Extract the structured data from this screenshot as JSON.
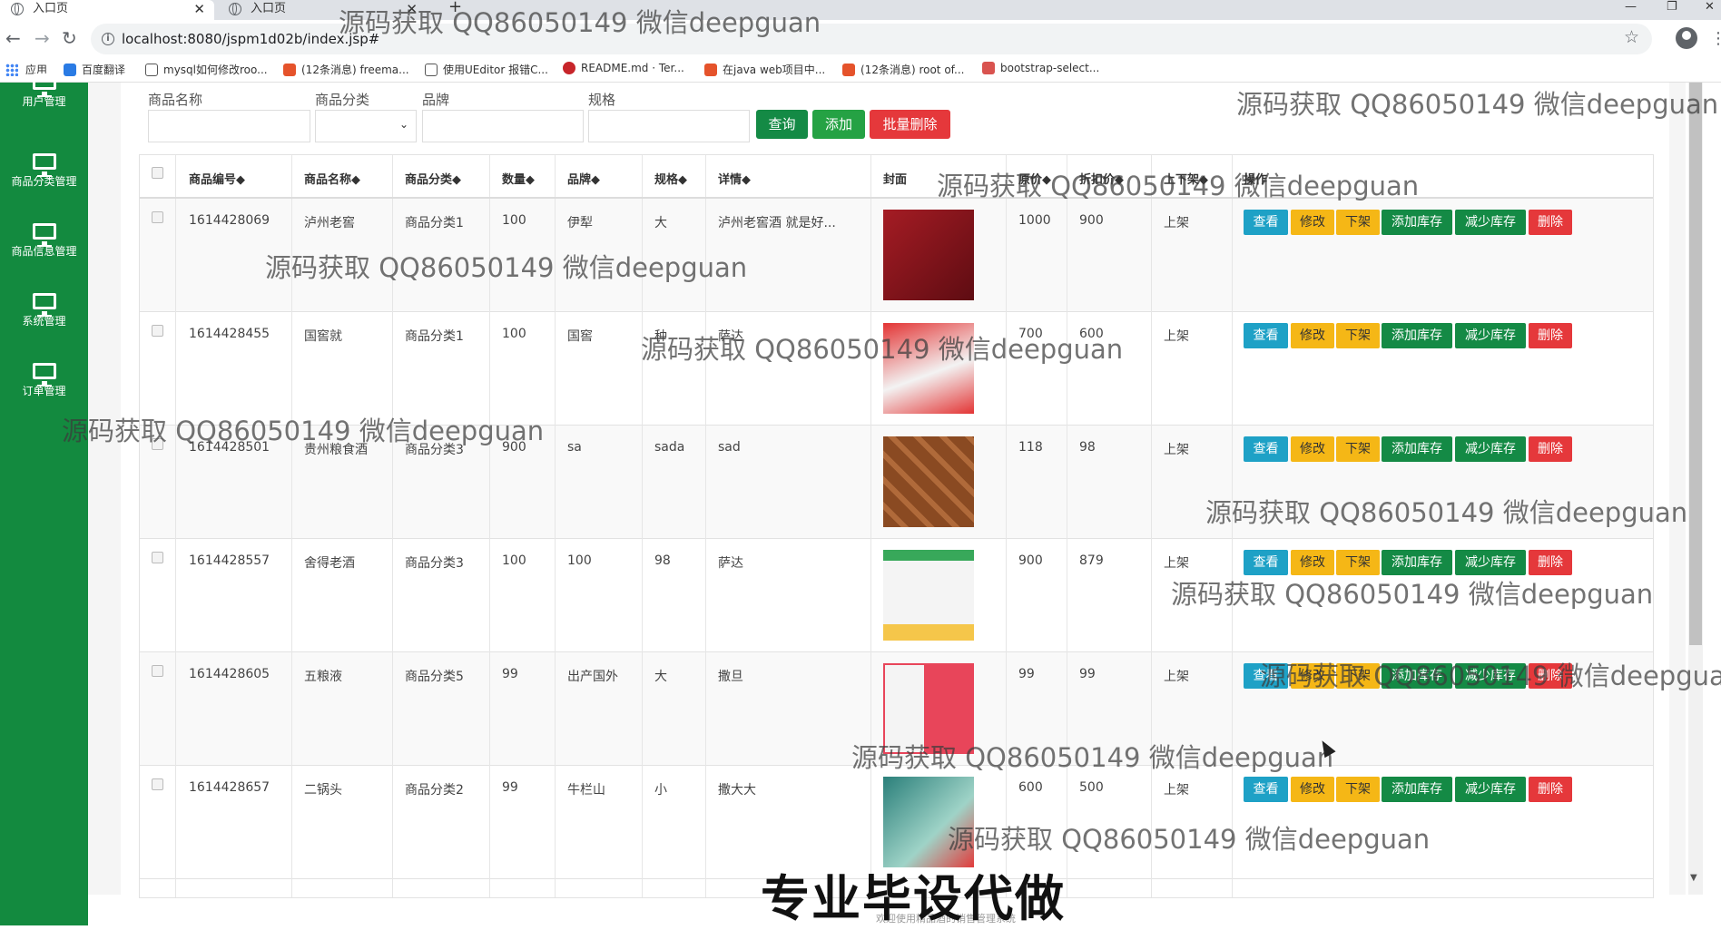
{
  "browser": {
    "tabs": [
      {
        "title": "入口页",
        "close": "✕"
      },
      {
        "title": "入口页",
        "close": "✕"
      }
    ],
    "new_tab": "+",
    "window_buttons": {
      "minimize": "—",
      "maximize": "❐",
      "close": "✕"
    },
    "url": "localhost:8080/jspm1d02b/index.jsp#",
    "bookmarks": [
      {
        "label": "应用",
        "color": "#4285f4"
      },
      {
        "label": "百度翻译",
        "color": "#2a7be4"
      },
      {
        "label": "mysql如何修改roo...",
        "color": "#555555"
      },
      {
        "label": "(12条消息) freema...",
        "color": "#e5532b"
      },
      {
        "label": "使用UEditor 报错C...",
        "color": "#555555"
      },
      {
        "label": "README.md · Ter...",
        "color": "#c7252a"
      },
      {
        "label": "在java web项目中...",
        "color": "#e5532b"
      },
      {
        "label": "(12条消息) root of...",
        "color": "#e5532b"
      },
      {
        "label": "bootstrap-select...",
        "color": "#d9534f"
      }
    ]
  },
  "sidebar": {
    "items": [
      {
        "label": "用户管理"
      },
      {
        "label": "商品分类管理"
      },
      {
        "label": "商品信息管理"
      },
      {
        "label": "系统管理"
      },
      {
        "label": "订单管理"
      }
    ]
  },
  "filters": {
    "name_label": "商品名称",
    "category_label": "商品分类",
    "brand_label": "品牌",
    "spec_label": "规格",
    "query_button": "查询",
    "add_button": "添加",
    "batch_delete_button": "批量删除"
  },
  "table": {
    "headers": [
      "商品编号◆",
      "商品名称◆",
      "商品分类◆",
      "数量◆",
      "品牌◆",
      "规格◆",
      "详情◆",
      "封面",
      "原价◆",
      "折扣价◆",
      "上下架◆",
      "操作"
    ],
    "actions": {
      "view": "查看",
      "edit": "修改",
      "off": "下架",
      "add_stock": "添加库存",
      "reduce_stock": "减少库存",
      "delete": "删除"
    },
    "rows": [
      {
        "id": "1614428069",
        "name": "泸州老窖",
        "category": "商品分类1",
        "qty": "100",
        "brand": "伊犁",
        "spec": "大",
        "detail": "泸州老窖酒 就是好...",
        "price": "1000",
        "discount": "900",
        "status": "上架",
        "cover": "#a51c24"
      },
      {
        "id": "1614428455",
        "name": "国窖就",
        "category": "商品分类1",
        "qty": "100",
        "brand": "国窖",
        "spec": "种",
        "detail": "萨达",
        "price": "700",
        "discount": "600",
        "status": "上架",
        "cover": "#e33434"
      },
      {
        "id": "1614428501",
        "name": "贵州粮食酒",
        "category": "商品分类3",
        "qty": "900",
        "brand": "sa",
        "spec": "sada",
        "detail": "sad",
        "price": "118",
        "discount": "98",
        "status": "上架",
        "cover": "#8a4a22"
      },
      {
        "id": "1614428557",
        "name": "舍得老酒",
        "category": "商品分类3",
        "qty": "100",
        "brand": "100",
        "spec": "98",
        "detail": "萨达",
        "price": "900",
        "discount": "879",
        "status": "上架",
        "cover": "#c9e7d2"
      },
      {
        "id": "1614428605",
        "name": "五粮液",
        "category": "商品分类5",
        "qty": "99",
        "brand": "出产国外",
        "spec": "大",
        "detail": "撒旦",
        "price": "99",
        "discount": "99",
        "status": "上架",
        "cover": "#e8455a"
      },
      {
        "id": "1614428657",
        "name": "二锅头",
        "category": "商品分类2",
        "qty": "99",
        "brand": "牛栏山",
        "spec": "小",
        "detail": "撒大大",
        "price": "600",
        "discount": "500",
        "status": "上架",
        "cover": "#2a7f7a"
      }
    ]
  },
  "watermark": "源码获取 QQ86050149 微信deepguan",
  "overlay_caption": "专业毕设代做",
  "footer": "欢迎使用精品酒的销售管理系统"
}
